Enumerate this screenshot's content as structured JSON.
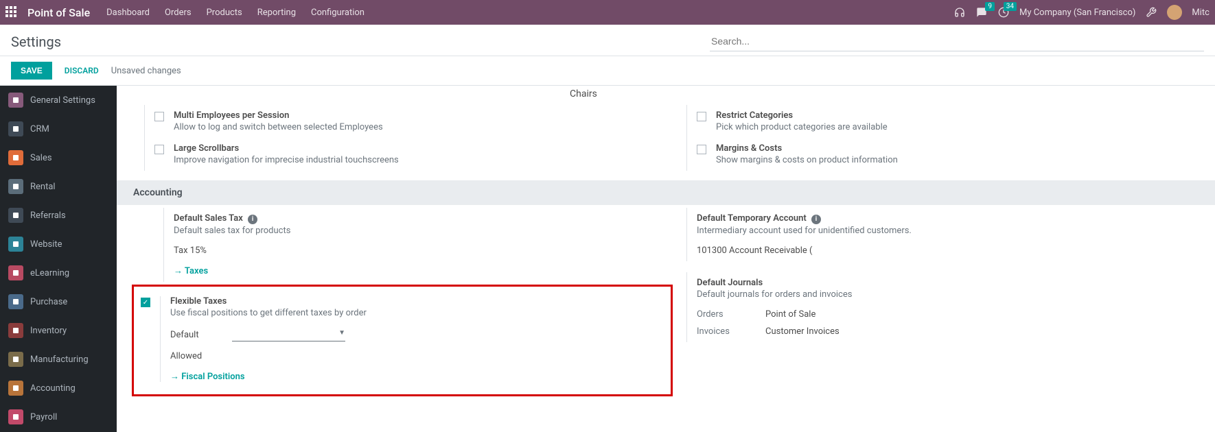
{
  "topbar": {
    "app_title": "Point of Sale",
    "nav": [
      "Dashboard",
      "Orders",
      "Products",
      "Reporting",
      "Configuration"
    ],
    "msg_count": "9",
    "clock_count": "34",
    "company": "My Company (San Francisco)",
    "user_short": "Mitc"
  },
  "header": {
    "title": "Settings",
    "search_placeholder": "Search...",
    "save": "SAVE",
    "discard": "DISCARD",
    "status": "Unsaved changes"
  },
  "sidebar": [
    {
      "label": "General Settings",
      "color": "#875A7B"
    },
    {
      "label": "CRM",
      "color": "#3f4a56"
    },
    {
      "label": "Sales",
      "color": "#e06c3a"
    },
    {
      "label": "Rental",
      "color": "#5b6d7a"
    },
    {
      "label": "Referrals",
      "color": "#3f4a56"
    },
    {
      "label": "Website",
      "color": "#2c8397"
    },
    {
      "label": "eLearning",
      "color": "#b84a62"
    },
    {
      "label": "Purchase",
      "color": "#4a6a8a"
    },
    {
      "label": "Inventory",
      "color": "#8a3c3c"
    },
    {
      "label": "Manufacturing",
      "color": "#7a6c4a"
    },
    {
      "label": "Accounting",
      "color": "#b8743a"
    },
    {
      "label": "Payroll",
      "color": "#c24a6a"
    }
  ],
  "top_ref": "Chairs",
  "interface_left": [
    {
      "title": "Multi Employees per Session",
      "desc": "Allow to log and switch between selected Employees"
    },
    {
      "title": "Large Scrollbars",
      "desc": "Improve navigation for imprecise industrial touchscreens"
    }
  ],
  "interface_right": [
    {
      "title": "Restrict Categories",
      "desc": "Pick which product categories are available"
    },
    {
      "title": "Margins & Costs",
      "desc": "Show margins & costs on product information"
    }
  ],
  "section_accounting": "Accounting",
  "acc_left": {
    "sales_tax_title": "Default Sales Tax",
    "sales_tax_desc": "Default sales tax for products",
    "sales_tax_value": "Tax 15%",
    "taxes_link": "Taxes",
    "flexible_title": "Flexible Taxes",
    "flexible_desc": "Use fiscal positions to get different taxes by order",
    "default_label": "Default",
    "allowed_label": "Allowed",
    "fiscal_link": "Fiscal Positions"
  },
  "acc_right": {
    "temp_title": "Default Temporary Account",
    "temp_desc": "Intermediary account used for unidentified customers.",
    "temp_value": "101300 Account Receivable (",
    "journals_title": "Default Journals",
    "journals_desc": "Default journals for orders and invoices",
    "orders_label": "Orders",
    "orders_value": "Point of Sale",
    "invoices_label": "Invoices",
    "invoices_value": "Customer Invoices"
  }
}
